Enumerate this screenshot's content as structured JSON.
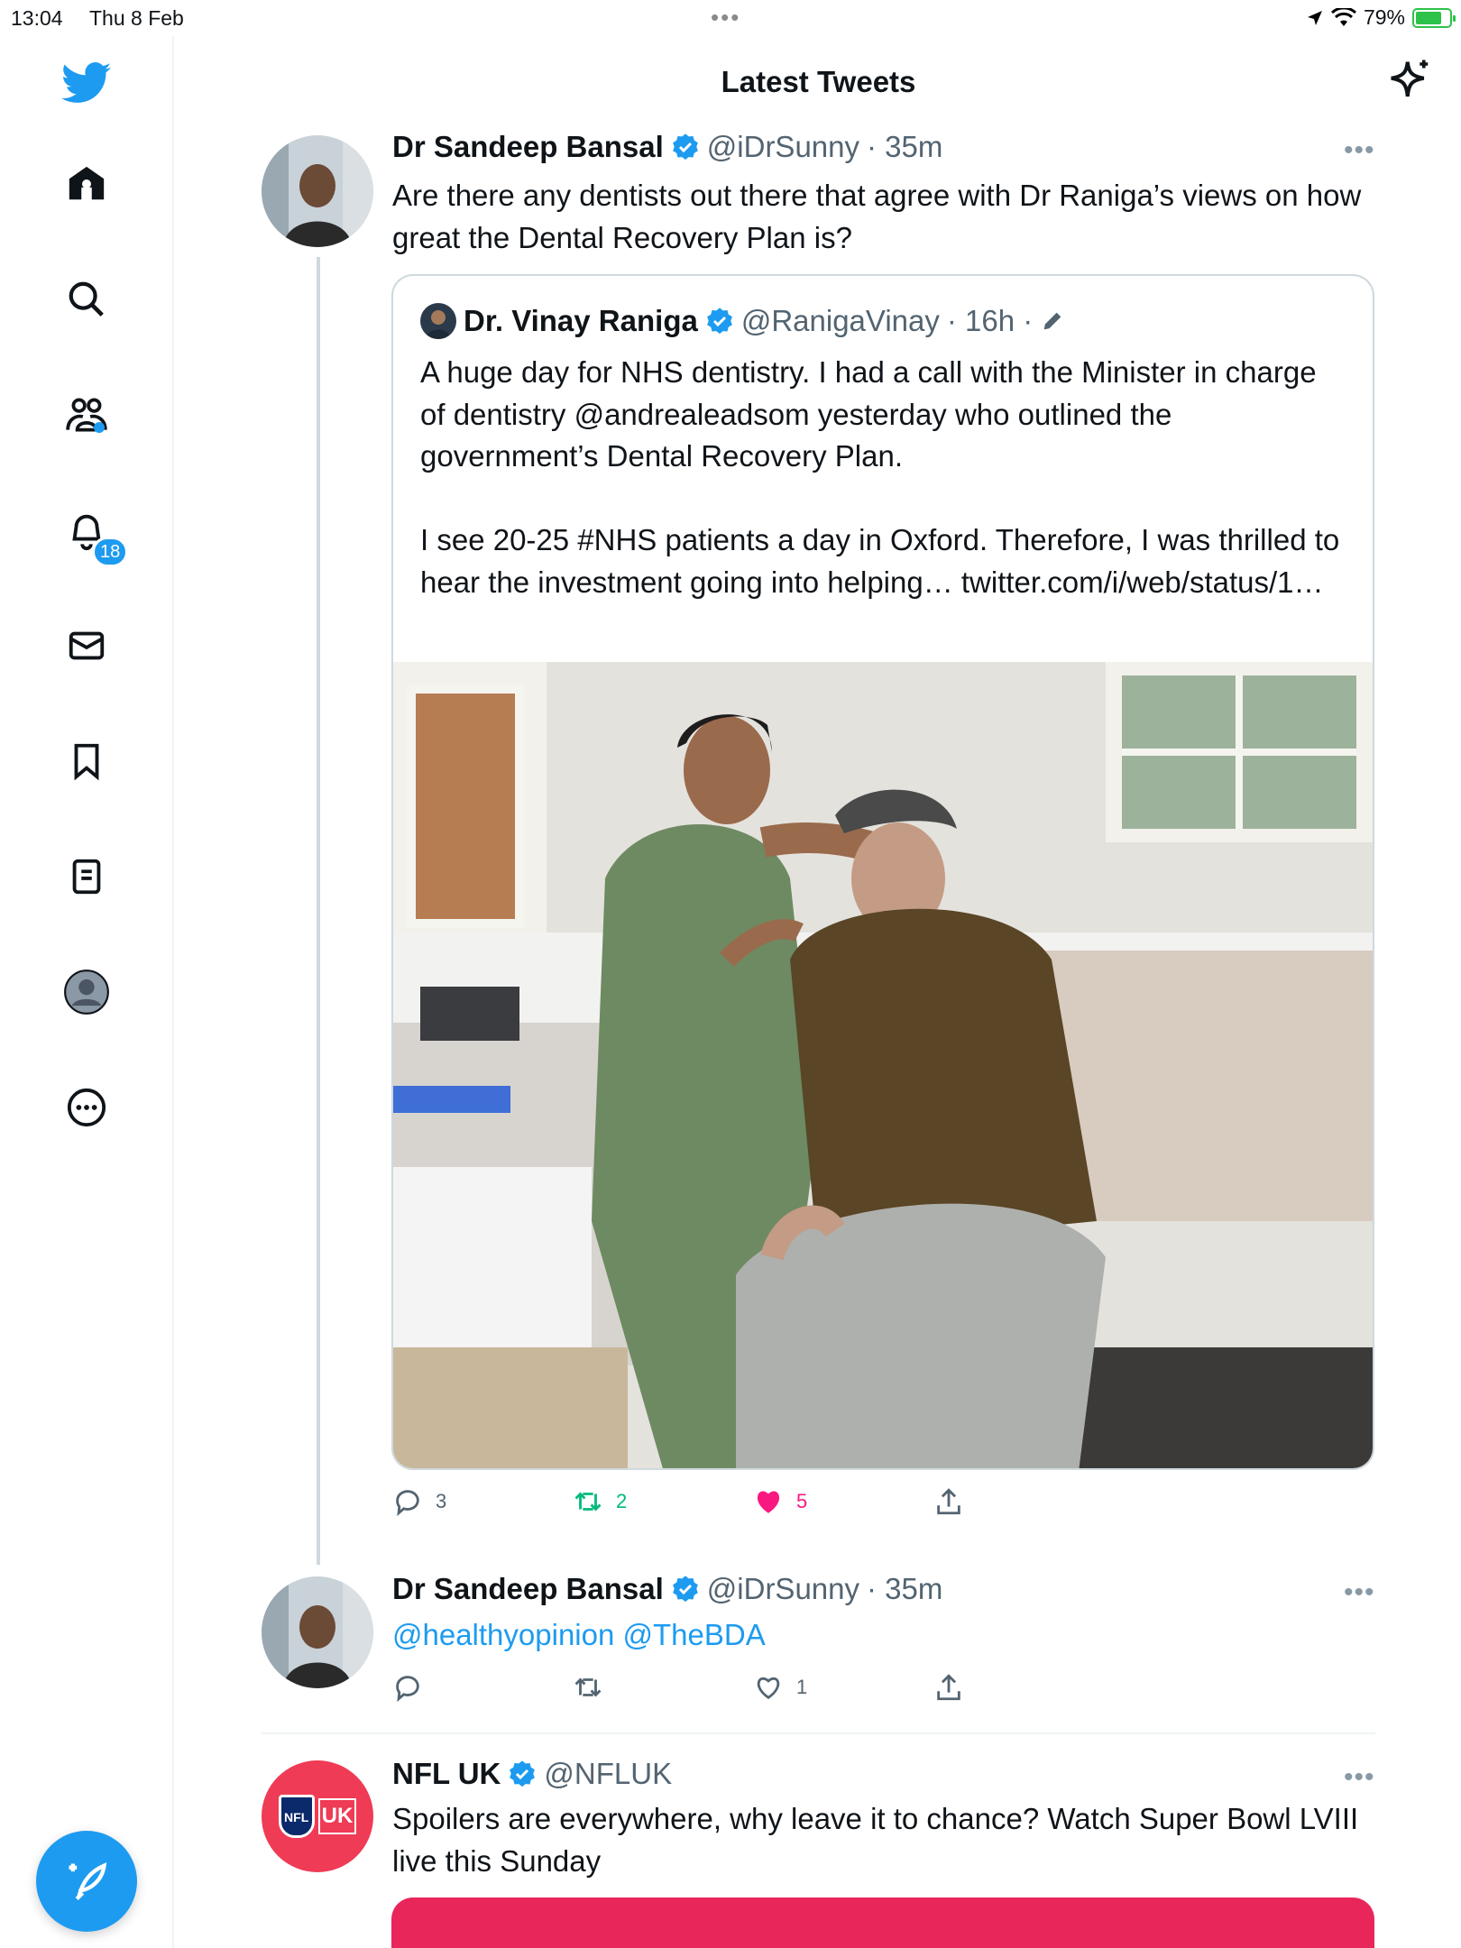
{
  "status_bar": {
    "time": "13:04",
    "date": "Thu 8 Feb",
    "battery": "79%",
    "battery_level": 0.79
  },
  "header": {
    "title": "Latest Tweets"
  },
  "sidebar": {
    "notifications_badge": "18",
    "icons": [
      "twitter-logo-icon",
      "home-icon",
      "search-icon",
      "communities-icon",
      "bell-icon",
      "mail-icon",
      "bookmark-icon",
      "lists-icon",
      "profile-icon",
      "more-circle-icon",
      "compose-icon"
    ]
  },
  "colors": {
    "accent": "#1d9bf0",
    "like": "#f91880",
    "retweet": "#00ba7c",
    "text": "#0f1419",
    "muted": "#536471"
  },
  "tweets": [
    {
      "name": "Dr Sandeep Bansal",
      "handle": "@iDrSunny",
      "time": "· 35m",
      "text": "Are there any dentists out there that agree with Dr Raniga’s views on how great the Dental Recovery Plan is?",
      "quote": {
        "name": "Dr. Vinay Raniga",
        "handle": "@RanigaVinay",
        "time": "· 16h ·",
        "text": "A huge day for NHS dentistry. I had a call with the Minister in charge of dentistry @andrealeadsom yesterday who outlined the government’s Dental Recovery Plan.\n\nI see 20-25 #NHS patients a day in Oxford. Therefore, I was thrilled to hear the investment going into helping… twitter.com/i/web/status/1…"
      },
      "replies": "3",
      "retweets": "2",
      "likes": "5"
    },
    {
      "name": "Dr Sandeep Bansal",
      "handle": "@iDrSunny",
      "time": "· 35m",
      "mentions": "@healthyopinion @TheBDA",
      "replies": "",
      "retweets": "",
      "likes": "1"
    },
    {
      "name": "NFL UK",
      "handle": "@NFLUK",
      "text": "Spoilers are everywhere, why leave it to chance? Watch Super Bowl LVIII live this Sunday",
      "logo_text": "NFL",
      "logo_sub": "UK"
    }
  ]
}
